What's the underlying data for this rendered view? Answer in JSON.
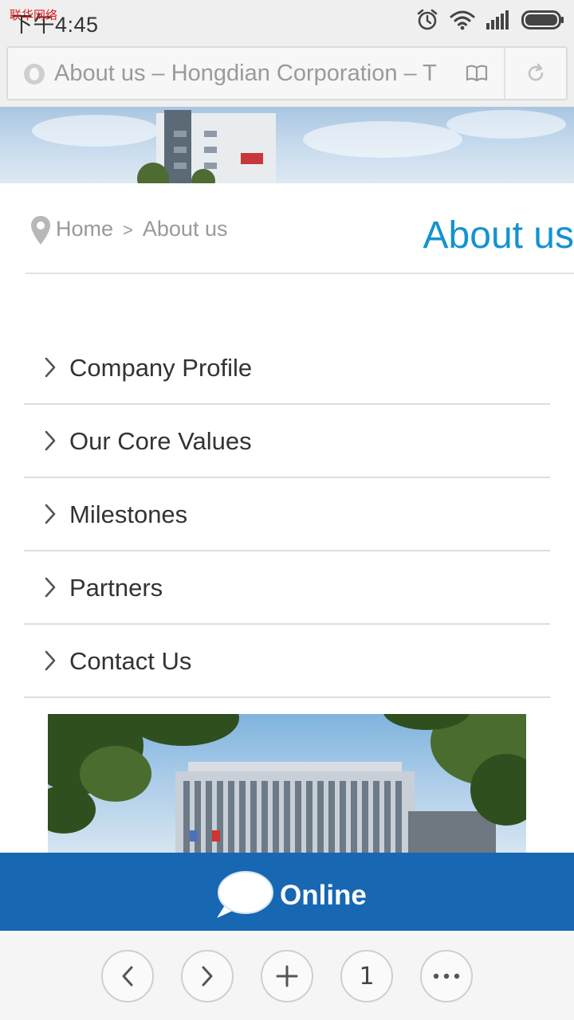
{
  "status_bar": {
    "time": "下午4:45",
    "carrier": "联华网络"
  },
  "browser": {
    "page_title": "About us – Hongdian Corporation – TI",
    "icons": [
      "site-icon",
      "reader-mode-icon",
      "reload-icon"
    ]
  },
  "breadcrumb": {
    "home": "Home",
    "separator": ">",
    "current": "About us"
  },
  "page": {
    "title": "About us"
  },
  "menu": {
    "items": [
      {
        "label": "Company Profile"
      },
      {
        "label": "Our Core Values"
      },
      {
        "label": "Milestones"
      },
      {
        "label": "Partners"
      },
      {
        "label": "Contact Us"
      }
    ]
  },
  "online": {
    "label": "Online"
  },
  "toolbar": {
    "tab_count": "1",
    "buttons": [
      "back-icon",
      "forward-icon",
      "new-tab-icon",
      "tabs",
      "more-icon"
    ]
  },
  "colors": {
    "accent": "#1493cf",
    "online_bar": "#1767b3",
    "carrier_text": "#d81e1e"
  }
}
